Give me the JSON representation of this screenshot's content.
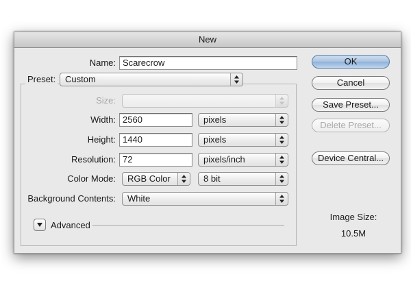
{
  "window": {
    "title": "New"
  },
  "form": {
    "name_label": "Name:",
    "name_value": "Scarecrow",
    "preset_label": "Preset:",
    "preset_value": "Custom",
    "size_label": "Size:",
    "size_value": "",
    "width_label": "Width:",
    "width_value": "2560",
    "width_unit": "pixels",
    "height_label": "Height:",
    "height_value": "1440",
    "height_unit": "pixels",
    "resolution_label": "Resolution:",
    "resolution_value": "72",
    "resolution_unit": "pixels/inch",
    "color_mode_label": "Color Mode:",
    "color_mode_value": "RGB Color",
    "bit_depth_value": "8 bit",
    "background_label": "Background Contents:",
    "background_value": "White",
    "advanced_label": "Advanced"
  },
  "buttons": {
    "ok": "OK",
    "cancel": "Cancel",
    "save_preset": "Save Preset...",
    "delete_preset": "Delete Preset...",
    "device_central": "Device Central..."
  },
  "image_size": {
    "label": "Image Size:",
    "value": "10.5M"
  },
  "icons": {
    "popup_arrows": "up-down-arrows-icon",
    "disclosure": "disclosure-triangle-icon"
  },
  "colors": {
    "dialog_bg": "#e9e9e9",
    "default_button": "#a9c3e0",
    "disabled_text": "#a8a8a8"
  }
}
